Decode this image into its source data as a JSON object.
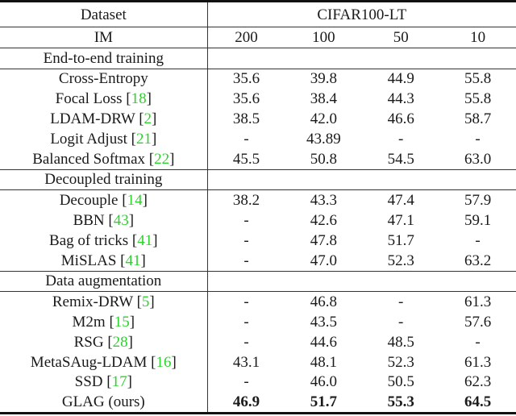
{
  "header": {
    "dataset_label": "Dataset",
    "dataset_name": "CIFAR100-LT",
    "im_label": "IM",
    "im_values": [
      "200",
      "100",
      "50",
      "10"
    ]
  },
  "sections": [
    {
      "title": "End-to-end training",
      "rows": [
        {
          "method": "Cross-Entropy",
          "ref": "",
          "values": [
            "35.6",
            "39.8",
            "44.9",
            "55.8"
          ]
        },
        {
          "method": "Focal Loss",
          "ref": "18",
          "values": [
            "35.6",
            "38.4",
            "44.3",
            "55.8"
          ]
        },
        {
          "method": "LDAM-DRW",
          "ref": "2",
          "values": [
            "38.5",
            "42.0",
            "46.6",
            "58.7"
          ]
        },
        {
          "method": "Logit Adjust",
          "ref": "21",
          "values": [
            "-",
            "43.89",
            "-",
            "-"
          ]
        },
        {
          "method": "Balanced Softmax",
          "ref": "22",
          "values": [
            "45.5",
            "50.8",
            "54.5",
            "63.0"
          ]
        }
      ]
    },
    {
      "title": "Decoupled training",
      "rows": [
        {
          "method": "Decouple",
          "ref": "14",
          "values": [
            "38.2",
            "43.3",
            "47.4",
            "57.9"
          ]
        },
        {
          "method": "BBN",
          "ref": "43",
          "values": [
            "-",
            "42.6",
            "47.1",
            "59.1"
          ]
        },
        {
          "method": "Bag of tricks",
          "ref": "41",
          "values": [
            "-",
            "47.8",
            "51.7",
            "-"
          ]
        },
        {
          "method": "MiSLAS",
          "ref": "41",
          "values": [
            "-",
            "47.0",
            "52.3",
            "63.2"
          ]
        }
      ]
    },
    {
      "title": "Data augmentation",
      "rows": [
        {
          "method": "Remix-DRW",
          "ref": "5",
          "values": [
            "-",
            "46.8",
            "-",
            "61.3"
          ]
        },
        {
          "method": "M2m",
          "ref": "15",
          "values": [
            "-",
            "43.5",
            "-",
            "57.6"
          ]
        },
        {
          "method": "RSG",
          "ref": "28",
          "values": [
            "-",
            "44.6",
            "48.5",
            "-"
          ]
        },
        {
          "method": "MetaSAug-LDAM",
          "ref": "16",
          "values": [
            "43.1",
            "48.1",
            "52.3",
            "61.3"
          ]
        },
        {
          "method": "SSD",
          "ref": "17",
          "values": [
            "-",
            "46.0",
            "50.5",
            "62.3"
          ]
        },
        {
          "method": "GLAG (ours)",
          "ref": "",
          "values": [
            "46.9",
            "51.7",
            "55.3",
            "64.5"
          ],
          "bold": true
        }
      ]
    }
  ],
  "colors": {
    "citation": "#2ed12e",
    "rule": "#111111"
  }
}
